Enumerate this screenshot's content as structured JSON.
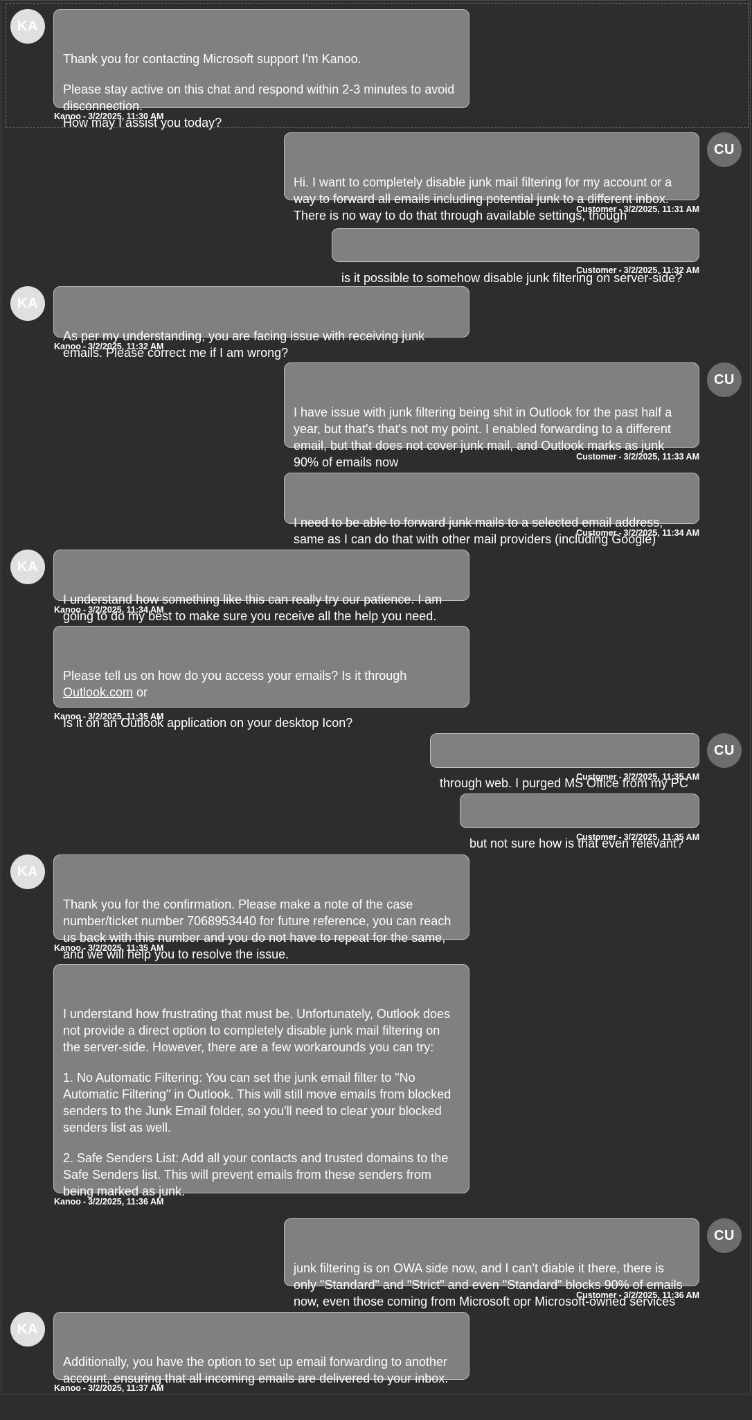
{
  "agent_avatar": "KA",
  "customer_avatar": "CU",
  "messages": [
    {
      "sender": "Kanoo",
      "time": "3/2/2025, 11:30 AM",
      "paragraphs": [
        "Thank you for contacting Microsoft support I'm Kanoo.",
        "Please stay active on this chat and respond within 2-3 minutes to avoid disconnection.\nHow may I assist you today?"
      ]
    },
    {
      "sender": "Customer",
      "time": "3/2/2025, 11:31 AM",
      "paragraphs": [
        "Hi. I want to completely disable junk mail filtering for my account or a way to forward all emails including potential junk to a different inbox. There is no way to do that through available settings, though"
      ]
    },
    {
      "sender": "Customer",
      "time": "3/2/2025, 11:32 AM",
      "paragraphs": [
        "is it possible to somehow disable junk filtering on server-side?"
      ]
    },
    {
      "sender": "Kanoo",
      "time": "3/2/2025, 11:32 AM",
      "paragraphs": [
        "As per my understanding, you are facing issue with receiving junk emails. Please correct me if I am wrong?"
      ]
    },
    {
      "sender": "Customer",
      "time": "3/2/2025, 11:33 AM",
      "paragraphs": [
        "I have issue with junk filtering being shit in Outlook for the past half a year, but that's that's not my point. I enabled forwarding to a different email, but that does not cover junk mail, and Outlook marks as junk 90% of emails now"
      ]
    },
    {
      "sender": "Customer",
      "time": "3/2/2025, 11:34 AM",
      "paragraphs": [
        "I need to be able to forward junk mails to a selected email address, same as I can do that with other mail providers (including Google)"
      ]
    },
    {
      "sender": "Kanoo",
      "time": "3/2/2025, 11:34 AM",
      "paragraphs": [
        "I understand how something like this can really try our patience. I am going to do my best to make sure you receive all the help you need."
      ]
    },
    {
      "sender": "Kanoo",
      "time": "3/2/2025, 11:35 AM",
      "para1_prefix": "Please tell us on how do you access your emails? Is it through ",
      "link": "Outlook.com",
      "para1_suffix": " or",
      "para2": "Is it on an Outlook application on your desktop Icon?"
    },
    {
      "sender": "Customer",
      "time": "3/2/2025, 11:35 AM",
      "paragraphs": [
        "through web. I purged MS Office from my PC"
      ]
    },
    {
      "sender": "Customer",
      "time": "3/2/2025, 11:35 AM",
      "paragraphs": [
        "but not sure how is that even relevant?"
      ]
    },
    {
      "sender": "Kanoo",
      "time": "3/2/2025, 11:35 AM",
      "paragraphs": [
        "Thank you for the confirmation. Please make a note of the case number/ticket number 7068953440 for future reference, you can reach us back with this number and you do not have to repeat for the same, and we will help you to resolve the issue."
      ]
    },
    {
      "sender": "Kanoo",
      "time": "3/2/2025, 11:36 AM",
      "paragraphs": [
        "I understand how frustrating that must be. Unfortunately, Outlook does not provide a direct option to completely disable junk mail filtering on the server-side. However, there are a few workarounds you can try:",
        "1. No Automatic Filtering: You can set the junk email filter to \"No Automatic Filtering\" in Outlook. This will still move emails from blocked senders to the Junk Email folder, so you'll need to clear your blocked senders list as well.",
        "2. Safe Senders List: Add all your contacts and trusted domains to the Safe Senders list. This will prevent emails from these senders from being marked as junk."
      ]
    },
    {
      "sender": "Customer",
      "time": "3/2/2025, 11:36 AM",
      "paragraphs": [
        "junk filtering is on OWA side now, and I can't diable it there, there is only \"Standard\" and \"Strict\" and even \"Standard\" blocks 90% of emails now, even those coming from Microsoft opr Microsoft-owned services"
      ]
    },
    {
      "sender": "Kanoo",
      "time": "3/2/2025, 11:37 AM",
      "paragraphs": [
        "Additionally, you have the option to set up email forwarding to another account, ensuring that all incoming emails are delivered to your inbox."
      ]
    }
  ]
}
